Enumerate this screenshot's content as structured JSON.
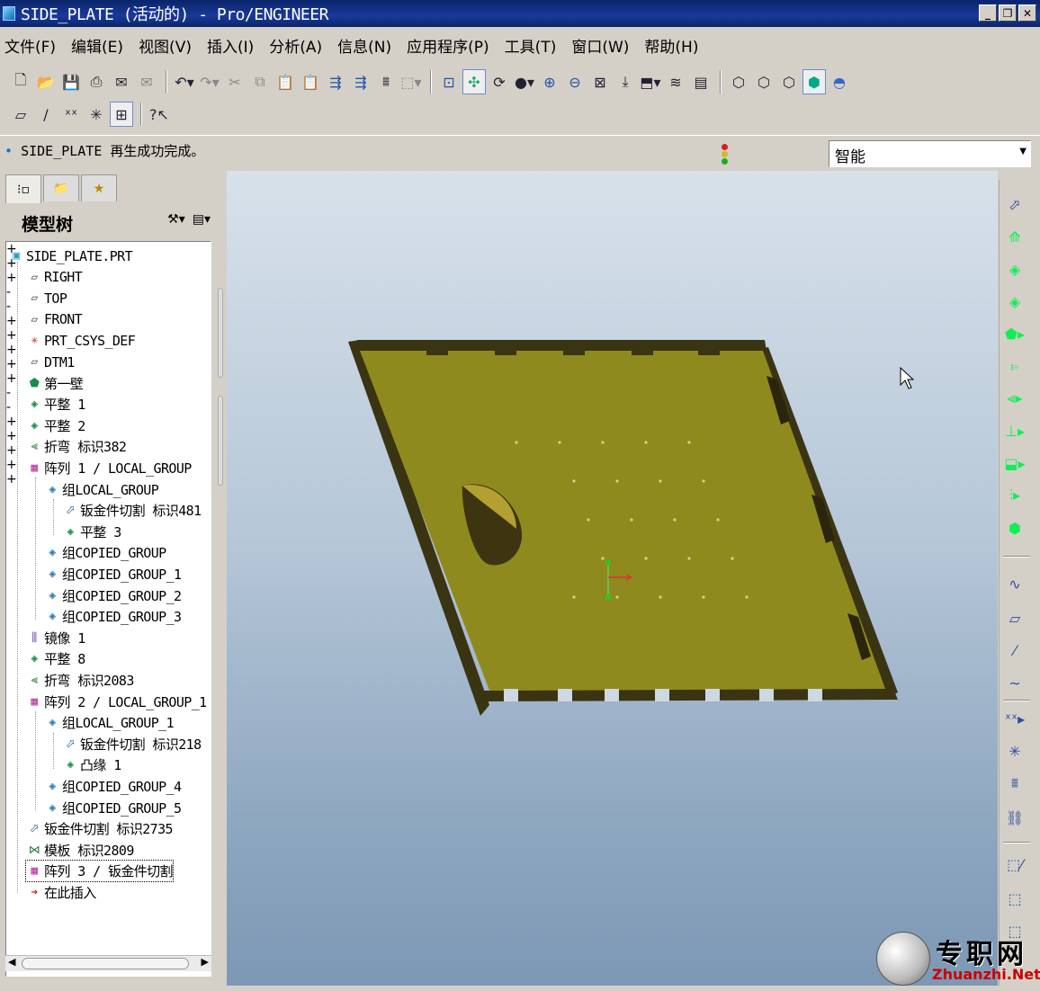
{
  "window": {
    "title": "SIDE_PLATE (活动的) - Pro/ENGINEER",
    "buttons": [
      "_",
      "❐",
      "✕"
    ]
  },
  "menu": [
    "文件(F)",
    "编辑(E)",
    "视图(V)",
    "插入(I)",
    "分析(A)",
    "信息(N)",
    "应用程序(P)",
    "工具(T)",
    "窗口(W)",
    "帮助(H)"
  ],
  "status": {
    "message": "SIDE_PLATE 再生成功完成。",
    "filter_value": "智能",
    "traffic_colors": [
      "#cc2222",
      "#ccbb22",
      "#22aa22"
    ]
  },
  "model_tree": {
    "header": "模型树",
    "nodes": [
      {
        "label": "SIDE_PLATE.PRT",
        "icon": "part-icon"
      },
      {
        "label": "RIGHT",
        "icon": "datum-plane-icon"
      },
      {
        "label": "TOP",
        "icon": "datum-plane-icon"
      },
      {
        "label": "FRONT",
        "icon": "datum-plane-icon"
      },
      {
        "label": "PRT_CSYS_DEF",
        "icon": "csys-icon"
      },
      {
        "label": "DTM1",
        "icon": "datum-plane-icon"
      },
      {
        "label": "第一壁",
        "icon": "first-wall-icon"
      },
      {
        "label": "平整 1",
        "icon": "flat-wall-icon"
      },
      {
        "label": "平整 2",
        "icon": "flat-wall-icon"
      },
      {
        "label": "折弯 标识382",
        "icon": "bend-icon"
      },
      {
        "label": "阵列 1 / LOCAL_GROUP",
        "icon": "pattern-icon"
      },
      {
        "label": "组LOCAL_GROUP",
        "icon": "group-icon"
      },
      {
        "label": "钣金件切割 标识481",
        "icon": "sheetmetal-cut-icon"
      },
      {
        "label": "平整 3",
        "icon": "flat-wall-icon"
      },
      {
        "label": "组COPIED_GROUP",
        "icon": "group-icon"
      },
      {
        "label": "组COPIED_GROUP_1",
        "icon": "group-icon"
      },
      {
        "label": "组COPIED_GROUP_2",
        "icon": "group-icon"
      },
      {
        "label": "组COPIED_GROUP_3",
        "icon": "group-icon"
      },
      {
        "label": "镜像 1",
        "icon": "mirror-icon"
      },
      {
        "label": "平整 8",
        "icon": "flat-wall-icon"
      },
      {
        "label": "折弯 标识2083",
        "icon": "bend-icon"
      },
      {
        "label": "阵列 2 / LOCAL_GROUP_1",
        "icon": "pattern-icon"
      },
      {
        "label": "组LOCAL_GROUP_1",
        "icon": "group-icon"
      },
      {
        "label": "钣金件切割 标识218",
        "icon": "sheetmetal-cut-icon"
      },
      {
        "label": "凸缘 1",
        "icon": "flange-icon"
      },
      {
        "label": "组COPIED_GROUP_4",
        "icon": "group-icon"
      },
      {
        "label": "组COPIED_GROUP_5",
        "icon": "group-icon"
      },
      {
        "label": "钣金件切割 标识2735",
        "icon": "sheetmetal-cut-icon"
      },
      {
        "label": "模板 标识2809",
        "icon": "form-icon"
      },
      {
        "label": "阵列 3 / 钣金件切割",
        "icon": "pattern-icon"
      },
      {
        "label": "在此插入",
        "icon": "insert-here-icon"
      }
    ]
  },
  "watermark": {
    "cn": "专职网",
    "en": "Zhuanzhi.Net"
  },
  "colors": {
    "part": "#8f8a1e",
    "part_dark": "#3a3412",
    "viewport_top": "#d7e1ea",
    "viewport_bottom": "#7d98b5"
  }
}
